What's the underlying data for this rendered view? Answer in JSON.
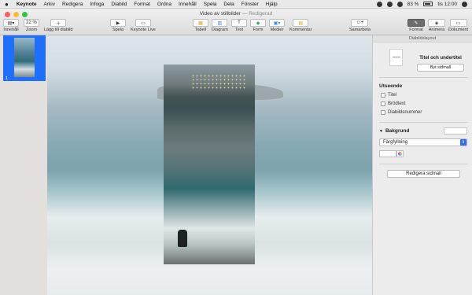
{
  "menubar": {
    "app_name": "Keynote",
    "items": [
      "Arkiv",
      "Redigera",
      "Infoga",
      "Diabild",
      "Format",
      "Ordna",
      "Innehåll",
      "Spela",
      "Dela",
      "Fönster",
      "Hjälp"
    ],
    "battery": "83 %",
    "clock": "tis 12:00"
  },
  "window": {
    "title": "Video av stillbilder",
    "status": "— Redigerad"
  },
  "toolbar": {
    "view_label": "Innehåll",
    "zoom_value": "22 %",
    "zoom_label": "Zoom",
    "add_slide_label": "Lägg till diabild",
    "play_label": "Spela",
    "keynote_live_label": "Keynote Live",
    "table_label": "Tabell",
    "chart_label": "Diagram",
    "text_label": "Text",
    "shape_label": "Form",
    "media_label": "Medier",
    "comment_label": "Kommentar",
    "collaborate_label": "Samarbeta",
    "format_label": "Format",
    "animate_label": "Animera",
    "document_label": "Dokument"
  },
  "navigator": {
    "slide_number": "1"
  },
  "inspector": {
    "header": "Diabildslayout",
    "layout_name": "Titel och undertitel",
    "change_master": "Byt sidmall",
    "appearance_title": "Utseende",
    "checkboxes": [
      "Titel",
      "Brödtext",
      "Diabildsnummer"
    ],
    "background_title": "Bakgrund",
    "fill_type": "Färgfyllning",
    "edit_master": "Redigera sidmall"
  }
}
